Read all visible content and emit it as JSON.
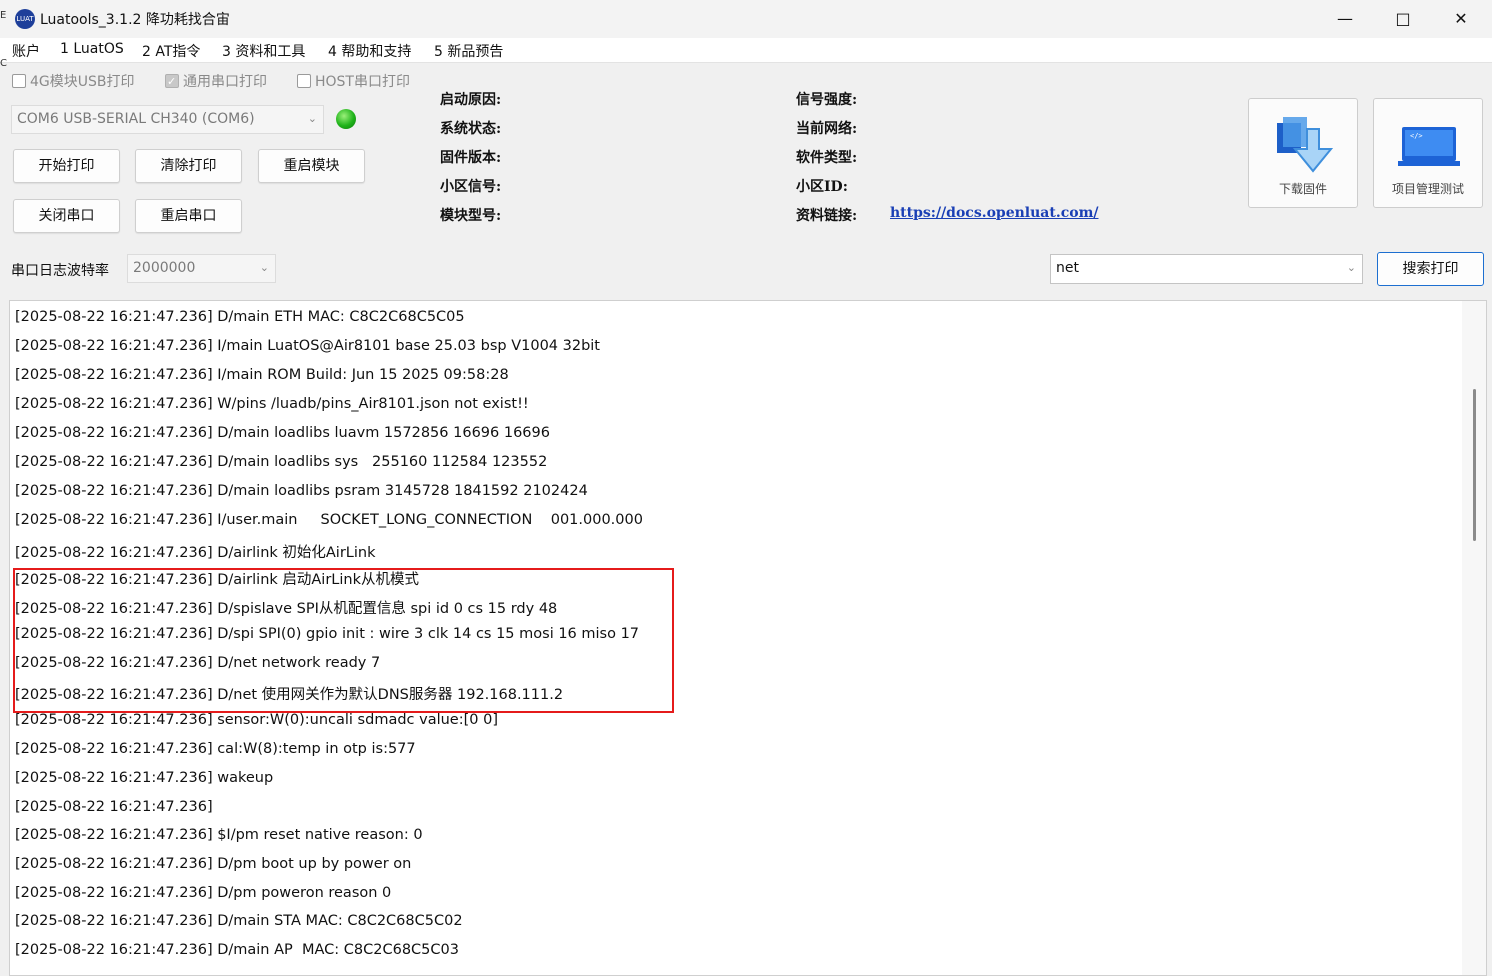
{
  "window": {
    "title": "Luatools_3.1.2 降功耗找合宙",
    "icon_text": "LUAT",
    "controls": [
      "minimize",
      "maximize",
      "close"
    ]
  },
  "menu": [
    "账户",
    "1 LuatOS",
    "2 AT指令",
    "3 资料和工具",
    "4 帮助和支持",
    "5 新品预告"
  ],
  "edge_marks": [
    "E",
    "C"
  ],
  "checkboxes": [
    {
      "label": "4G模块USB打印",
      "checked": false
    },
    {
      "label": "通用串口打印",
      "checked": true
    },
    {
      "label": "HOST串口打印",
      "checked": false
    }
  ],
  "port_select": {
    "value": "COM6 USB-SERIAL CH340 (COM6)"
  },
  "status_led": {
    "color": "#1fb31a"
  },
  "buttons": {
    "start_print": "开始打印",
    "clear_print": "清除打印",
    "restart_module": "重启模块",
    "close_port": "关闭串口",
    "restart_port": "重启串口",
    "search_print": "搜索打印"
  },
  "info": {
    "boot_reason": "启动原因:",
    "system_status": "系统状态:",
    "firmware_version": "固件版本:",
    "cell_signal": "小区信号:",
    "module_model": "模块型号:",
    "signal_strength": "信号强度:",
    "current_network": "当前网络:",
    "software_type": "软件类型:",
    "cell_id": "小区ID:",
    "docs_link_label": "资料链接:",
    "docs_link": "https://docs.openluat.com/"
  },
  "tools": {
    "download_firmware": "下载固件",
    "project_management": "项目管理测试"
  },
  "baud": {
    "label": "串口日志波特率",
    "value": "2000000"
  },
  "search": {
    "value": "net"
  },
  "log_lines": [
    "[2025-08-22 16:21:47.236] D/main ETH MAC: C8C2C68C5C05",
    "[2025-08-22 16:21:47.236] I/main LuatOS@Air8101 base 25.03 bsp V1004 32bit",
    "[2025-08-22 16:21:47.236] I/main ROM Build: Jun 15 2025 09:58:28",
    "[2025-08-22 16:21:47.236] W/pins /luadb/pins_Air8101.json not exist!!",
    "[2025-08-22 16:21:47.236] D/main loadlibs luavm 1572856 16696 16696",
    "[2025-08-22 16:21:47.236] D/main loadlibs sys   255160 112584 123552",
    "[2025-08-22 16:21:47.236] D/main loadlibs psram 3145728 1841592 2102424",
    "[2025-08-22 16:21:47.236] I/user.main     SOCKET_LONG_CONNECTION    001.000.000",
    "[2025-08-22 16:21:47.236] D/airlink 初始化AirLink",
    "[2025-08-22 16:21:47.236] D/airlink 启动AirLink从机模式",
    "[2025-08-22 16:21:47.236] D/spislave SPI从机配置信息 spi id 0 cs 15 rdy 48",
    "[2025-08-22 16:21:47.236] D/spi SPI(0) gpio init : wire 3 clk 14 cs 15 mosi 16 miso 17",
    "[2025-08-22 16:21:47.236] D/net network ready 7",
    "[2025-08-22 16:21:47.236] D/net 使用网关作为默认DNS服务器 192.168.111.2",
    "[2025-08-22 16:21:47.236] sensor:W(0):uncali sdmadc value:[0 0]",
    "[2025-08-22 16:21:47.236] cal:W(8):temp in otp is:577",
    "[2025-08-22 16:21:47.236] wakeup",
    "[2025-08-22 16:21:47.236]",
    "[2025-08-22 16:21:47.236] $I/pm reset native reason: 0",
    "[2025-08-22 16:21:47.236] D/pm boot up by power on",
    "[2025-08-22 16:21:47.236] D/pm poweron reason 0",
    "[2025-08-22 16:21:47.236] D/main STA MAC: C8C2C68C5C02",
    "[2025-08-22 16:21:47.236] D/main AP  MAC: C8C2C68C5C03"
  ],
  "highlight": {
    "color": "#e51b1b",
    "first_line": 9,
    "last_line": 13
  }
}
